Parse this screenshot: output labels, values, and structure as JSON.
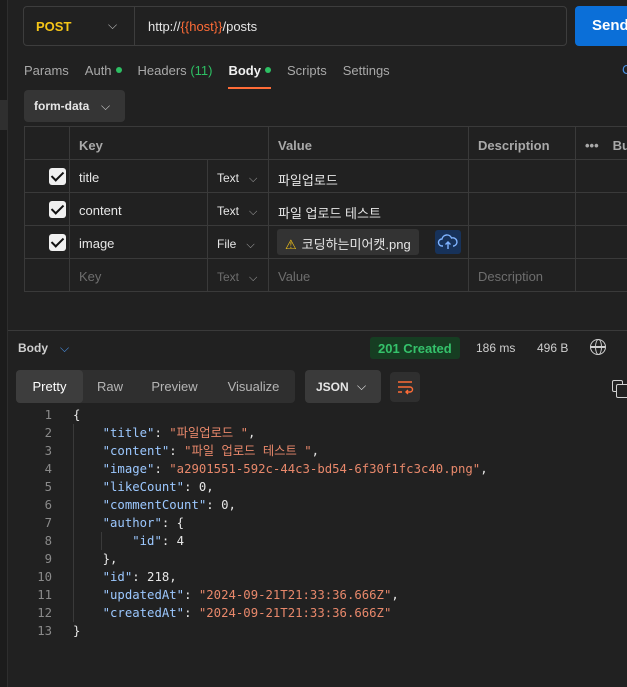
{
  "request": {
    "method": "POST",
    "url_prefix": "http://",
    "url_var": "{{host}}",
    "url_suffix": "/posts",
    "send_label": "Send"
  },
  "tabs": [
    {
      "label": "Params"
    },
    {
      "label": "Auth"
    },
    {
      "label": "Headers",
      "count": "(11)"
    },
    {
      "label": "Body"
    },
    {
      "label": "Scripts"
    },
    {
      "label": "Settings"
    }
  ],
  "tab_right": "C",
  "body_mode": "form-data",
  "params_table": {
    "headers": {
      "key": "Key",
      "value": "Value",
      "description": "Description",
      "more": "•••",
      "bulk": "Bu"
    },
    "rows": [
      {
        "key": "title",
        "type": "Text",
        "value": "파일업로드"
      },
      {
        "key": "content",
        "type": "Text",
        "value": "파일 업로드 테스트"
      },
      {
        "key": "image",
        "type": "File",
        "value": "코딩하는미어캣.png"
      }
    ],
    "placeholder": {
      "key": "Key",
      "type": "Text",
      "value": "Value",
      "description": "Description"
    }
  },
  "response": {
    "label": "Body",
    "status": "201 Created",
    "time": "186 ms",
    "size": "496 B",
    "view_tabs": [
      "Pretty",
      "Raw",
      "Preview",
      "Visualize"
    ],
    "format": "JSON"
  },
  "code_lines": [
    {
      "n": "1",
      "t": "{"
    },
    {
      "n": "2",
      "t": "    \"title\": \"파일업로드 \","
    },
    {
      "n": "3",
      "t": "    \"content\": \"파일 업로드 테스트 \","
    },
    {
      "n": "4",
      "t": "    \"image\": \"a2901551-592c-44c3-bd54-6f30f1fc3c40.png\","
    },
    {
      "n": "5",
      "t": "    \"likeCount\": 0,"
    },
    {
      "n": "6",
      "t": "    \"commentCount\": 0,"
    },
    {
      "n": "7",
      "t": "    \"author\": {"
    },
    {
      "n": "8",
      "t": "        \"id\": 4"
    },
    {
      "n": "9",
      "t": "    },"
    },
    {
      "n": "10",
      "t": "    \"id\": 218,"
    },
    {
      "n": "11",
      "t": "    \"updatedAt\": \"2024-09-21T21:33:36.666Z\","
    },
    {
      "n": "12",
      "t": "    \"createdAt\": \"2024-09-21T21:33:36.666Z\""
    },
    {
      "n": "13",
      "t": "}"
    }
  ]
}
